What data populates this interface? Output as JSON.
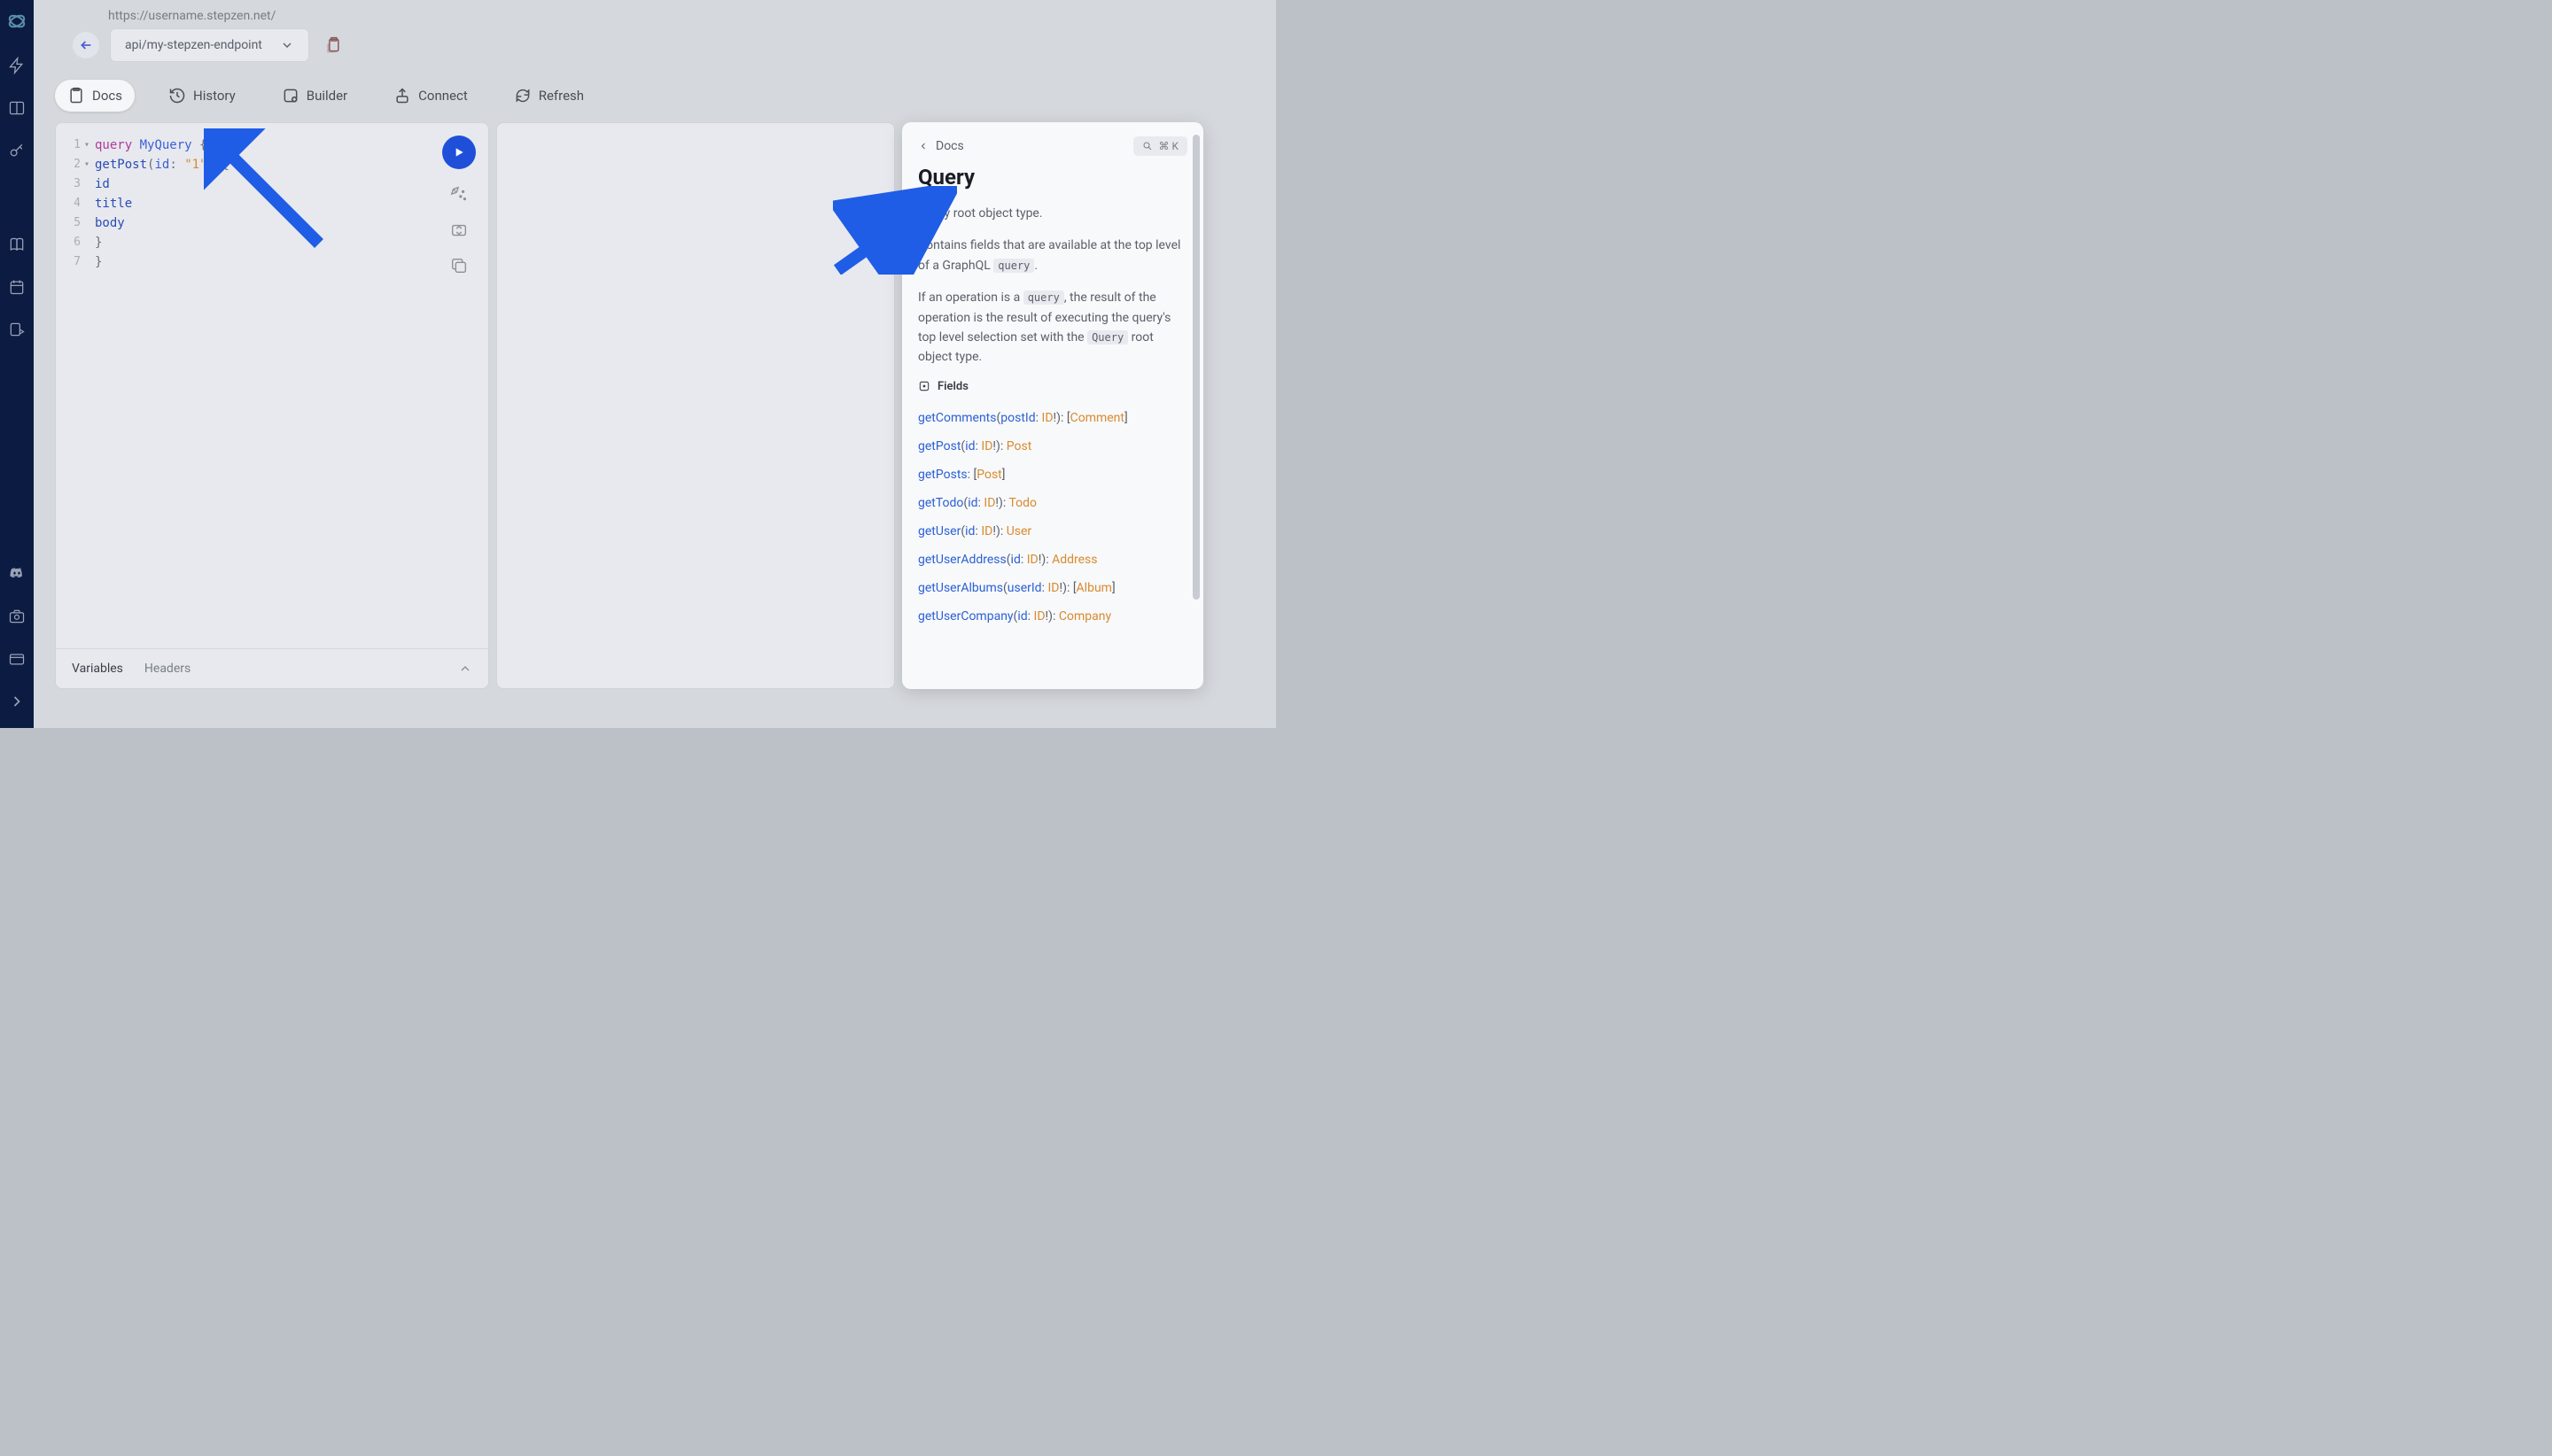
{
  "topbar": {
    "url": "https://username.stepzen.net/",
    "endpoint": "api/my-stepzen-endpoint"
  },
  "toolbar": {
    "docs": "Docs",
    "history": "History",
    "builder": "Builder",
    "connect": "Connect",
    "refresh": "Refresh"
  },
  "editor": {
    "lines": [
      {
        "n": 1,
        "fold": "▾",
        "tokens": [
          [
            "query",
            "kw-purple"
          ],
          [
            " ",
            "kw-black"
          ],
          [
            "MyQuery",
            "kw-blue"
          ],
          [
            " {",
            "kw-brace"
          ]
        ]
      },
      {
        "n": 2,
        "fold": "▾",
        "tokens": [
          [
            "  ",
            "kw-black"
          ],
          [
            "getPost",
            "kw-darkblue"
          ],
          [
            "(",
            "kw-brace"
          ],
          [
            "id",
            "kw-blue"
          ],
          [
            ":",
            "kw-brace"
          ],
          [
            " ",
            "kw-black"
          ],
          [
            "\"1\"",
            "kw-orange"
          ],
          [
            ")",
            "kw-brace"
          ],
          [
            " {",
            "kw-brace"
          ]
        ]
      },
      {
        "n": 3,
        "fold": "",
        "tokens": [
          [
            "    ",
            "kw-black"
          ],
          [
            "id",
            "kw-darkblue"
          ]
        ]
      },
      {
        "n": 4,
        "fold": "",
        "tokens": [
          [
            "    ",
            "kw-black"
          ],
          [
            "title",
            "kw-darkblue"
          ]
        ]
      },
      {
        "n": 5,
        "fold": "",
        "tokens": [
          [
            "    ",
            "kw-black"
          ],
          [
            "body",
            "kw-darkblue"
          ]
        ]
      },
      {
        "n": 6,
        "fold": "",
        "tokens": [
          [
            "  }",
            "kw-brace"
          ]
        ]
      },
      {
        "n": 7,
        "fold": "",
        "tokens": [
          [
            "}",
            "kw-brace"
          ]
        ]
      }
    ],
    "bottom_tabs": {
      "variables": "Variables",
      "headers": "Headers"
    }
  },
  "docs": {
    "breadcrumb": "Docs",
    "search_shortcut": "⌘ K",
    "title": "Query",
    "description1": "Query root object type.",
    "description2_pre": "Contains fields that are available at the top level of a GraphQL ",
    "description2_code": "query",
    "description2_post": ".",
    "description3_pre": "If an operation is a ",
    "description3_code1": "query",
    "description3_mid": ", the result of the operation is the result of executing the query's top level selection set with the ",
    "description3_code2": "Query",
    "description3_post": " root object type.",
    "fields_label": "Fields",
    "fields": [
      {
        "name": "getComments",
        "args": [
          {
            "name": "postId",
            "type": "ID",
            "nn": true
          }
        ],
        "ret": "Comment",
        "list": true
      },
      {
        "name": "getPost",
        "args": [
          {
            "name": "id",
            "type": "ID",
            "nn": true
          }
        ],
        "ret": "Post",
        "list": false
      },
      {
        "name": "getPosts",
        "args": [],
        "ret": "Post",
        "list": true
      },
      {
        "name": "getTodo",
        "args": [
          {
            "name": "id",
            "type": "ID",
            "nn": true
          }
        ],
        "ret": "Todo",
        "list": false
      },
      {
        "name": "getUser",
        "args": [
          {
            "name": "id",
            "type": "ID",
            "nn": true
          }
        ],
        "ret": "User",
        "list": false
      },
      {
        "name": "getUserAddress",
        "args": [
          {
            "name": "id",
            "type": "ID",
            "nn": true
          }
        ],
        "ret": "Address",
        "list": false
      },
      {
        "name": "getUserAlbums",
        "args": [
          {
            "name": "userId",
            "type": "ID",
            "nn": true
          }
        ],
        "ret": "Album",
        "list": true
      },
      {
        "name": "getUserCompany",
        "args": [
          {
            "name": "id",
            "type": "ID",
            "nn": true
          }
        ],
        "ret": "Company",
        "list": false
      }
    ]
  }
}
